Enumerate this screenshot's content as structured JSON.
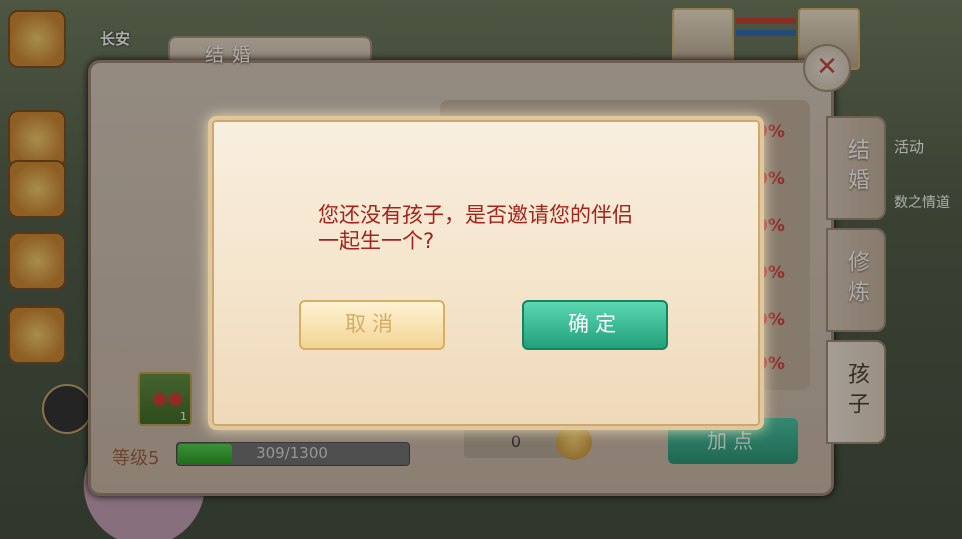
{
  "hud": {
    "city": "长安"
  },
  "panel": {
    "title": "结婚",
    "tabs": [
      {
        "label": "结婚"
      },
      {
        "label": "修炼"
      },
      {
        "label": "孩子"
      }
    ],
    "stat_suffixes": [
      "0%",
      "0%",
      "0%",
      "0%",
      "0%",
      "0%"
    ],
    "item_count": "1",
    "level_label": "等级5",
    "exp_text": "309/1300",
    "exp_fraction": 0.238,
    "points_value": "0",
    "add_point_label": "加点"
  },
  "dialog": {
    "message_line1": "您还没有孩子，是否邀请您的伴侣",
    "message_line2": "一起生一个?",
    "cancel_label": "取消",
    "confirm_label": "确定"
  },
  "right_hud": {
    "activity_label": "活动",
    "quest_label": "数之情道"
  },
  "colors": {
    "dialog_text": "#a6231c",
    "confirm": "#22a07b",
    "cancel_text": "#d6ac62",
    "exp_fill": "#23a21d"
  }
}
